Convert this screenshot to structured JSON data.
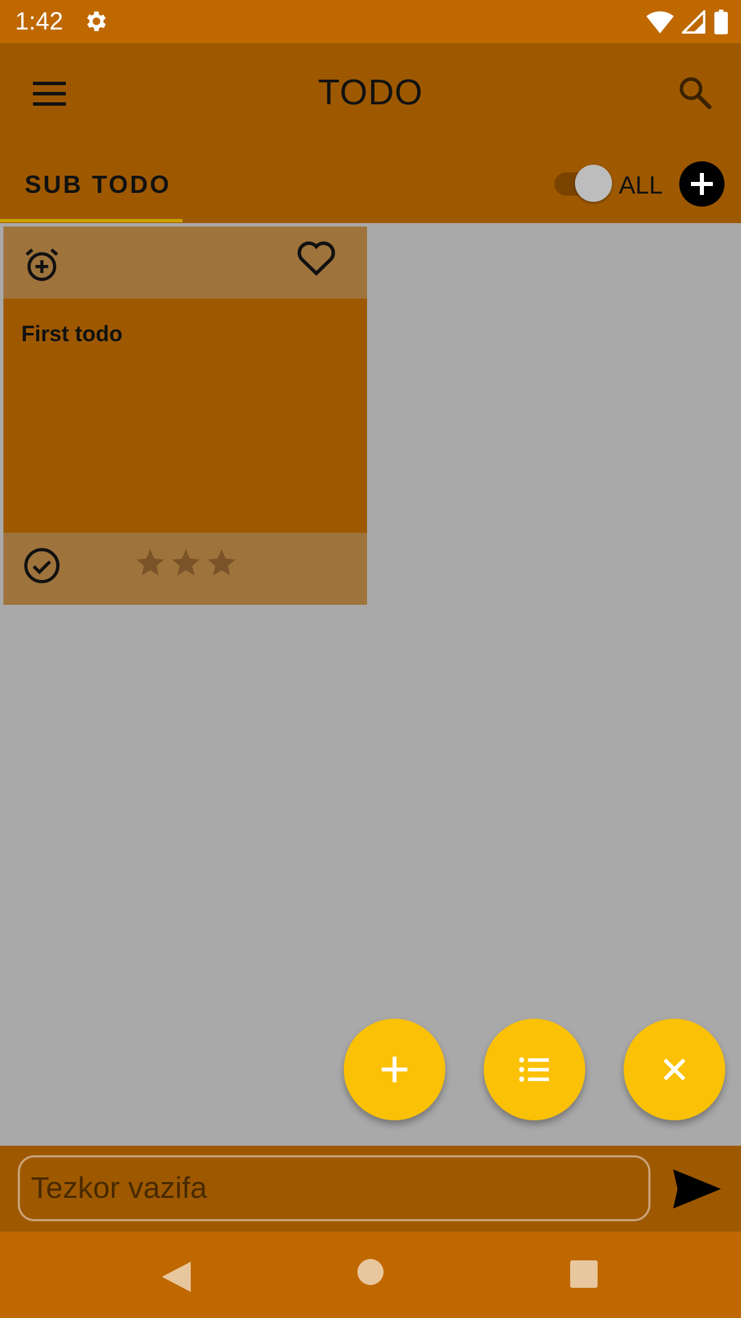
{
  "status_bar": {
    "time": "1:42",
    "icons": [
      "gear-icon",
      "wifi-icon",
      "signal-icon",
      "battery-icon"
    ]
  },
  "app_bar": {
    "title": "TODO",
    "menu_icon": "menu-icon",
    "search_icon": "search-icon"
  },
  "tabs": {
    "active_label": "SUB TODO",
    "toggle_label": "ALL",
    "toggle_on": true
  },
  "cards": [
    {
      "title": "First todo",
      "favorite": false,
      "done": false,
      "rating": 0,
      "max_rating": 3
    }
  ],
  "fabs": [
    {
      "icon": "plus-icon"
    },
    {
      "icon": "list-icon"
    },
    {
      "icon": "close-icon"
    }
  ],
  "quick_task": {
    "placeholder": "Tezkor vazifa",
    "value": ""
  },
  "colors": {
    "status_bar": "#bf6800",
    "app_bar": "#9e5900",
    "card_band": "#9e733c",
    "fab": "#fbc106",
    "background": "#a9a9a9"
  }
}
